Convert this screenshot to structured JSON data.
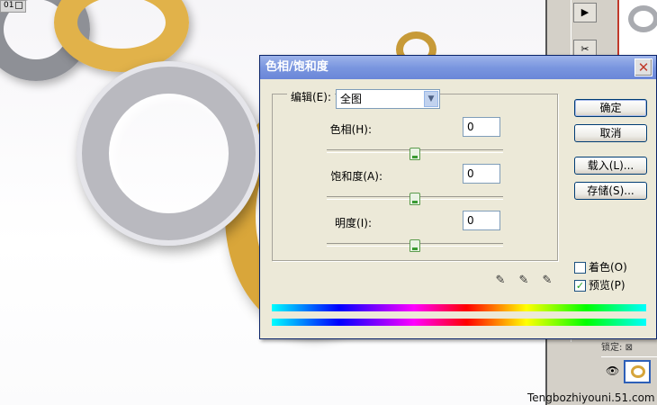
{
  "document": {
    "tab_label": "01"
  },
  "dialog": {
    "title": "色相/饱和度",
    "edit_label": "编辑(E):",
    "edit_value": "全图",
    "hue_label": "色相(H):",
    "hue_value": "0",
    "hue_slider": 0,
    "saturation_label": "饱和度(A):",
    "saturation_value": "0",
    "saturation_slider": 0,
    "lightness_label": "明度(I):",
    "lightness_value": "0",
    "lightness_slider": 0,
    "buttons": {
      "ok": "确定",
      "cancel": "取消",
      "load": "载入(L)...",
      "save": "存储(S)..."
    },
    "colorize_label": "着色(O)",
    "colorize_checked": false,
    "preview_label": "预览(P)",
    "preview_checked": true,
    "check_mark": "✓"
  },
  "layers": {
    "lock_label": "锁定:"
  },
  "watermark": "Tengbozhiyouni.51.com"
}
